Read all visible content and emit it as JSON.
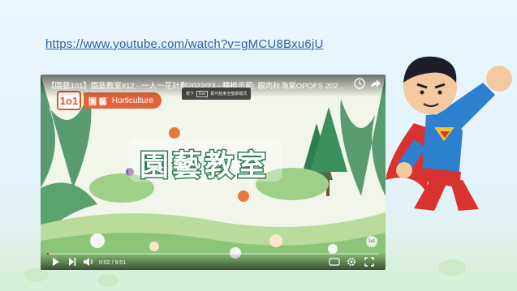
{
  "slide": {
    "link_text": "https://www.youtube.com/watch?v=gMCU8Bxu6jU"
  },
  "player": {
    "title": "【園藝101】園藝教室#12 · 一人一花計劃2022/23 - 種植示範: 銀肉秋海棠OPOFS 2022/23 -Pla...",
    "tooltip_key": "Esc",
    "tooltip_prefix": "按下",
    "tooltip_text": "即可結束全螢幕模式",
    "brand_logo": "1o1",
    "brand_cn": "園 藝",
    "brand_en": "Horticulture",
    "main_title": "園藝教室",
    "time": "0:02 / 9:51",
    "progress_fraction": 0.004,
    "corner_logo": "1o1"
  },
  "icons": {
    "clock": "watch-later-icon",
    "share": "share-icon",
    "play": "play-icon",
    "next": "next-icon",
    "volume": "volume-icon",
    "settings": "settings-icon",
    "fullscreen": "fullscreen-icon"
  },
  "colors": {
    "link": "#2a5fa8",
    "brand": "#e3643b",
    "title_stroke": "#2f7d52",
    "progress": "#ff0000"
  }
}
